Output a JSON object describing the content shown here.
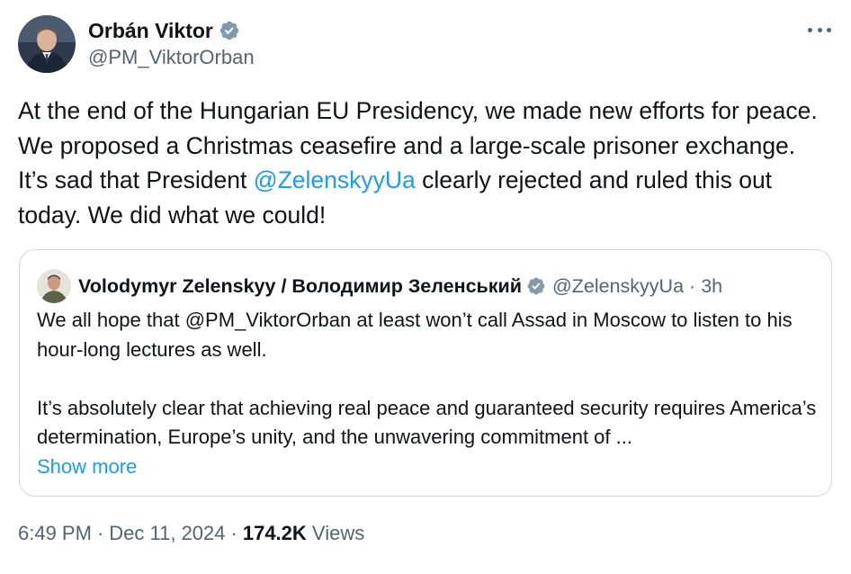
{
  "author": {
    "name": "Orbán Viktor",
    "handle": "@PM_ViktorOrban",
    "verified": true
  },
  "menu_icon": "more-horizontal-icon",
  "tweet": {
    "text_before": "At the end of the Hungarian EU Presidency, we made new efforts for peace. We proposed a Christmas ceasefire and a large-scale prisoner exchange. It’s sad that President ",
    "mention": "@ZelenskyyUa",
    "text_after": " clearly rejected and ruled this out today. We did what we could!"
  },
  "quote": {
    "name": "Volodymyr Zelenskyy / Володимир Зеленський",
    "handle": "@ZelenskyyUa",
    "separator": "·",
    "time": "3h",
    "paragraph1": "We all hope that @PM_ViktorOrban at least won’t call Assad in Moscow to listen to his hour-long lectures as well.",
    "paragraph2": "It’s absolutely clear that achieving real peace and guaranteed security requires America’s determination, Europe’s unity, and the unwavering commitment of ...",
    "show_more": "Show more"
  },
  "meta": {
    "time": "6:49 PM",
    "sep1": "·",
    "date": "Dec 11, 2024",
    "sep2": "·",
    "views_count": "174.2K",
    "views_label": "Views"
  },
  "colors": {
    "link": "#1d9bf0",
    "secondary_text": "#536471",
    "primary_text": "#0f1419",
    "border": "#cfd9de",
    "verified_badge": "#829aab"
  }
}
